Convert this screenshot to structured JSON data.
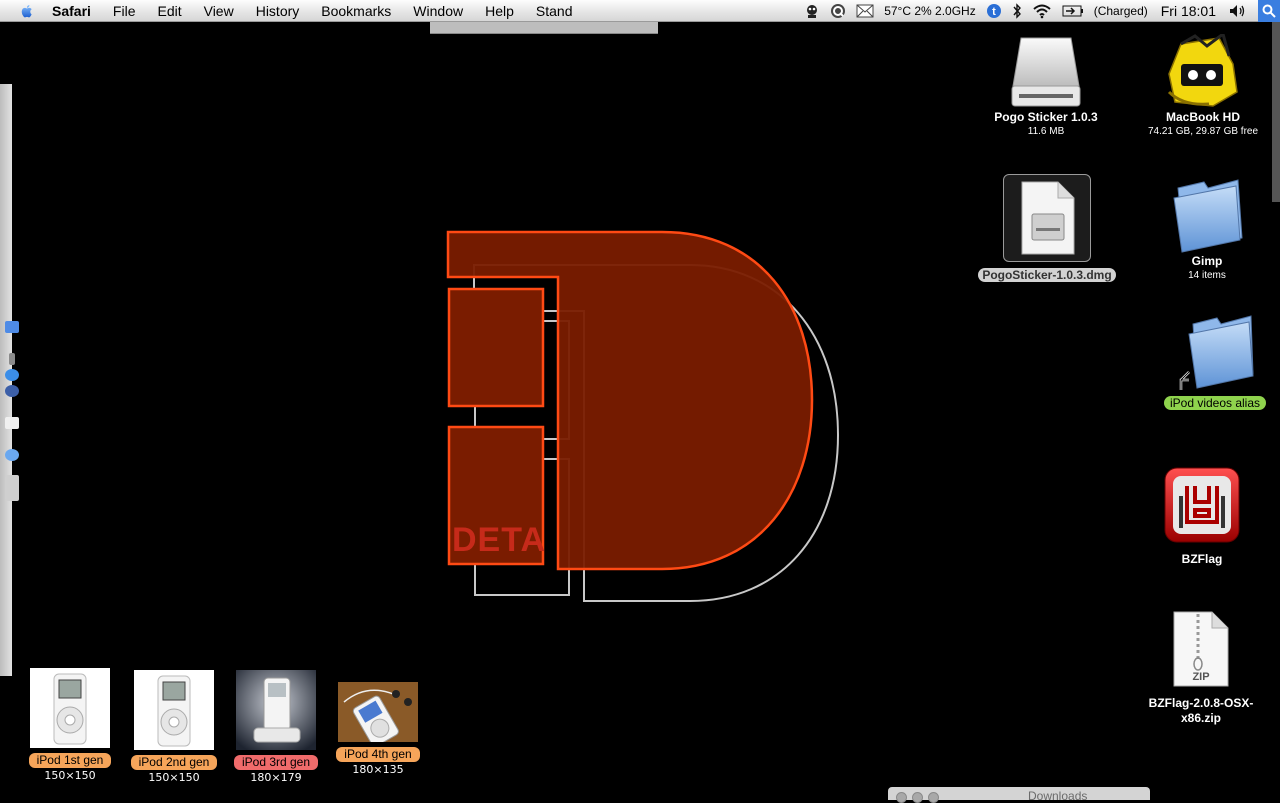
{
  "menubar": {
    "app": "Safari",
    "items": [
      "File",
      "Edit",
      "View",
      "History",
      "Bookmarks",
      "Window",
      "Help",
      "Stand"
    ],
    "status": {
      "cpu": "57°C 2% 2.0GHz",
      "battery": "(Charged)",
      "clock": "Fri 18:01"
    },
    "icons": [
      "apple-icon",
      "monitor-agent-icon",
      "quicksilver-icon",
      "mail-icon",
      "tweet-icon",
      "bluetooth-icon",
      "wifi-icon",
      "battery-icon",
      "volume-icon",
      "spotlight-icon"
    ]
  },
  "wallpaper": {
    "logo_text": "DETA",
    "colors": {
      "fill": "#7a1c00",
      "stroke": "#ff4a14",
      "shadow": "#c8c8c8"
    }
  },
  "desktop": {
    "icons": [
      {
        "name": "Pogo Sticker 1.0.3",
        "info": "11.6 MB",
        "icon": "disk-image-volume-icon"
      },
      {
        "name": "MacBook HD",
        "info": "74.21 GB, 29.87 GB free",
        "icon": "hard-drive-icon"
      },
      {
        "name": "PogoSticker-1.0.3.dmg",
        "info": "",
        "icon": "dmg-file-icon",
        "selected": true
      },
      {
        "name": "Gimp",
        "info": "14 items",
        "icon": "folder-icon"
      },
      {
        "name": "iPod videos alias",
        "info": "",
        "icon": "folder-alias-icon",
        "label_color": "#8fd34d"
      },
      {
        "name": "BZFlag",
        "info": "",
        "icon": "bzflag-app-icon"
      },
      {
        "name": "BZFlag-2.0.8-OSX-x86.zip",
        "info": "",
        "icon": "zip-file-icon",
        "badge": "ZIP"
      }
    ]
  },
  "thumbnails": [
    {
      "label": "iPod 1st gen",
      "dims": "150×150",
      "label_color": "#f6a55a"
    },
    {
      "label": "iPod 2nd gen",
      "dims": "150×150",
      "label_color": "#f6a55a"
    },
    {
      "label": "iPod 3rd gen",
      "dims": "180×179",
      "label_color": "#f06b6b"
    },
    {
      "label": "iPod 4th gen",
      "dims": "180×135",
      "label_color": "#f6a55a"
    }
  ],
  "downloads": {
    "title": "Downloads"
  }
}
